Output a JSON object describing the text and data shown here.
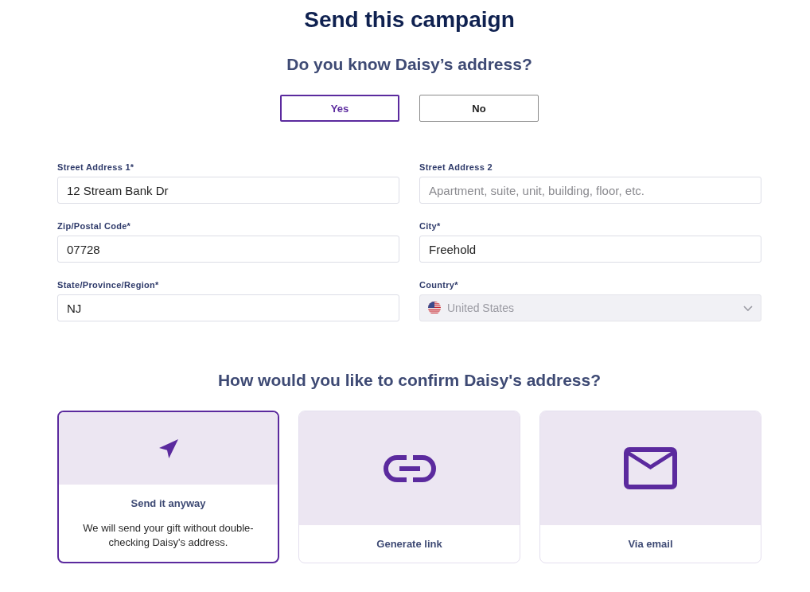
{
  "title": "Send this campaign",
  "address_question": {
    "heading": "Do you know Daisy’s address?",
    "options": [
      {
        "label": "Yes",
        "selected": true
      },
      {
        "label": "No",
        "selected": false
      }
    ]
  },
  "address_form": {
    "fields": [
      {
        "label": "Street Address 1*",
        "kind": "text",
        "value": "12 Stream Bank Dr",
        "disabled": false
      },
      {
        "label": "Street Address 2",
        "kind": "text",
        "placeholder": "Apartment, suite, unit, building, floor, etc.",
        "disabled": false
      },
      {
        "label": "Zip/Postal Code*",
        "kind": "text",
        "value": "07728",
        "disabled": false
      },
      {
        "label": "City*",
        "kind": "text",
        "value": "Freehold",
        "disabled": false
      },
      {
        "label": "State/Province/Region*",
        "kind": "text",
        "value": "NJ",
        "disabled": false
      },
      {
        "label": "Country*",
        "kind": "select",
        "value": "United States",
        "disabled": true
      }
    ]
  },
  "confirmation": {
    "heading": "How would you like to confirm Daisy's address?",
    "methods": [
      {
        "kind": "direct",
        "title": "Send it anyway",
        "description": "We will send your gift without double-checking Daisy's address.",
        "selected": true
      },
      {
        "kind": "link",
        "title": "Generate link",
        "selected": false
      },
      {
        "kind": "email",
        "title": "Via email",
        "selected": false
      }
    ]
  }
}
